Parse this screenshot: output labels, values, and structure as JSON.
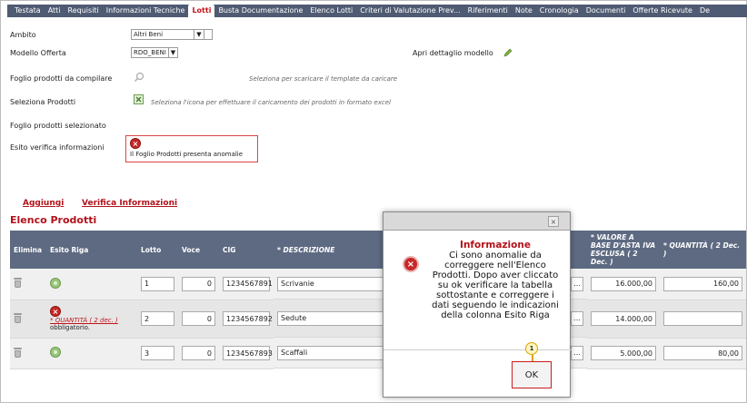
{
  "tabs": [
    {
      "label": "Testata",
      "active": false
    },
    {
      "label": "Atti",
      "active": false
    },
    {
      "label": "Requisiti",
      "active": false
    },
    {
      "label": "Informazioni Tecniche",
      "active": false
    },
    {
      "label": "Lotti",
      "active": true
    },
    {
      "label": "Busta Documentazione",
      "active": false
    },
    {
      "label": "Elenco Lotti",
      "active": false
    },
    {
      "label": "Criteri di Valutazione Prev...",
      "active": false
    },
    {
      "label": "Riferimenti",
      "active": false
    },
    {
      "label": "Note",
      "active": false
    },
    {
      "label": "Cronologia",
      "active": false
    },
    {
      "label": "Documenti",
      "active": false
    },
    {
      "label": "Offerte Ricevute",
      "active": false
    },
    {
      "label": "De",
      "active": false
    }
  ],
  "form": {
    "ambito_label": "Ambito",
    "ambito_value": "Altri Beni",
    "modello_label": "Modello Offerta",
    "modello_value": "RDO_BENI",
    "apri_dettaglio": "Apri dettaglio modello",
    "foglio_label": "Foglio prodotti da compilare",
    "foglio_hint": "Seleziona per scaricare il template da caricare",
    "seleziona_label": "Seleziona Prodotti",
    "seleziona_hint": "Seleziona l'icona per effettuare il caricamento dei prodotti in formato excel",
    "foglio_sel_label": "Foglio prodotti selezionato",
    "esito_label": "Esito verifica informazioni",
    "esito_text": "Il Foglio Prodotti presenta anomalie"
  },
  "links": {
    "aggiungi": "Aggiungi",
    "verifica": "Verifica Informazioni"
  },
  "section_title": "Elenco Prodotti",
  "table": {
    "headers": {
      "elimina": "Elimina",
      "esito": "Esito Riga",
      "lotto": "Lotto",
      "voce": "Voce",
      "cig": "CIG",
      "descrizione": "* DESCRIZIONE",
      "valore": "* VALORE A BASE D'ASTA IVA ESCLUSA ( 2 Dec. )",
      "quantita": "* QUANTITÀ ( 2 Dec. )"
    },
    "rows": [
      {
        "esito": "ok",
        "lotto": "1",
        "voce": "0",
        "cig": "1234567891",
        "descrizione": "Scrivanie",
        "valore": "16.000,00",
        "quantita": "160,00"
      },
      {
        "esito": "error",
        "error_field": "* QUANTITÀ ( 2 dec. )",
        "error_msg": "obbligatorio.",
        "lotto": "2",
        "voce": "0",
        "cig": "1234567892",
        "descrizione": "Sedute",
        "valore": "14.000,00",
        "quantita": ""
      },
      {
        "esito": "ok",
        "lotto": "3",
        "voce": "0",
        "cig": "1234567893",
        "descrizione": "Scaffali",
        "valore": "5.000,00",
        "quantita": "80,00"
      }
    ]
  },
  "modal": {
    "title": "Informazione",
    "message": "Ci sono anomalie da correggere nell'Elenco Prodotti. Dopo aver cliccato su ok verificare la tabella sottostante e correggere i dati seguendo le indicazioni della colonna Esito Riga",
    "ok_label": "OK",
    "callout_number": "1"
  },
  "colors": {
    "tab_bar": "#4f5b72",
    "accent_red": "#b2121a",
    "header_bg": "#5d6a82"
  }
}
